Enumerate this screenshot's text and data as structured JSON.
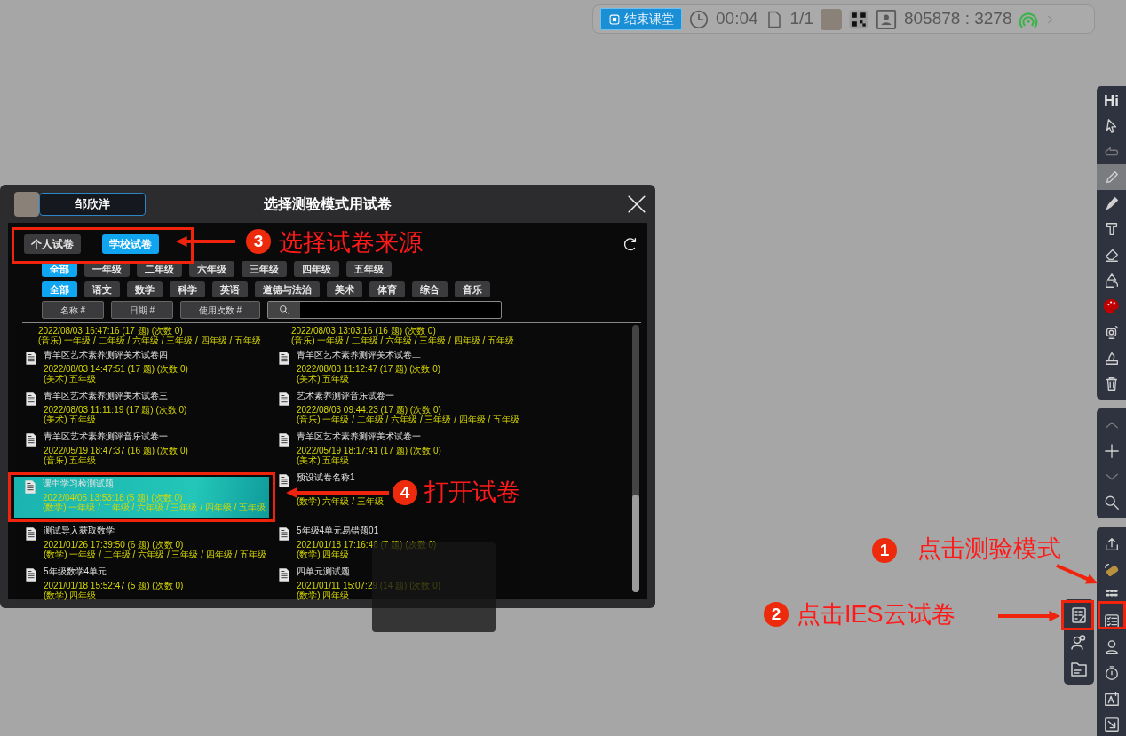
{
  "status_bar": {
    "end_button": "结束课堂",
    "timer": "00:04",
    "pages": "1/1",
    "room_code": "805878 : 3278"
  },
  "dialog": {
    "user_name": "邹欣洋",
    "title": "选择测验模式用试卷",
    "source_tabs": [
      {
        "label": "个人试卷",
        "selected": false
      },
      {
        "label": "学校试卷",
        "selected": true
      }
    ],
    "grade_filters": [
      {
        "label": "全部",
        "selected": true
      },
      {
        "label": "一年级",
        "selected": false
      },
      {
        "label": "二年级",
        "selected": false
      },
      {
        "label": "六年级",
        "selected": false
      },
      {
        "label": "三年级",
        "selected": false
      },
      {
        "label": "四年级",
        "selected": false
      },
      {
        "label": "五年级",
        "selected": false
      }
    ],
    "subject_filters": [
      {
        "label": "全部",
        "selected": true
      },
      {
        "label": "语文",
        "selected": false
      },
      {
        "label": "数学",
        "selected": false
      },
      {
        "label": "科学",
        "selected": false
      },
      {
        "label": "英语",
        "selected": false
      },
      {
        "label": "道德与法治",
        "selected": false
      },
      {
        "label": "美术",
        "selected": false
      },
      {
        "label": "体育",
        "selected": false
      },
      {
        "label": "综合",
        "selected": false
      },
      {
        "label": "音乐",
        "selected": false
      }
    ],
    "sort_buttons": [
      "名称 #",
      "日期 #",
      "使用次数 #"
    ],
    "papers": [
      {
        "date": "2022/08/03 16:47:16 (17 题) (次数 0)",
        "tags": "(音乐) 一年级 / 二年级 / 六年级 / 三年级 / 四年级 / 五年级",
        "selected": false
      },
      {
        "date": "2022/08/03 13:03:16 (16 题) (次数 0)",
        "tags": "(音乐) 一年级 / 二年级 / 六年级 / 三年级 / 四年级 / 五年级",
        "selected": false
      },
      {
        "title": "青羊区艺术素养测评美术试卷四",
        "date": "2022/08/03 14:47:51 (17 题) (次数 0)",
        "tags": "(美术) 五年级",
        "selected": false
      },
      {
        "title": "青羊区艺术素养测评美术试卷二",
        "date": "2022/08/03 11:12:47 (17 题) (次数 0)",
        "tags": "(美术) 五年级",
        "selected": false
      },
      {
        "title": "青羊区艺术素养测评美术试卷三",
        "date": "2022/08/03 11:11:19 (17 题) (次数 0)",
        "tags": "(美术) 五年级",
        "selected": false
      },
      {
        "title": "艺术素养测评音乐试卷一",
        "date": "2022/08/03 09:44:23 (17 题) (次数 0)",
        "tags": "(音乐) 一年级 / 二年级 / 六年级 / 三年级 / 四年级 / 五年级",
        "selected": false
      },
      {
        "title": "青羊区艺术素养测评音乐试卷一",
        "date": "2022/05/19 18:47:37 (16 题) (次数 0)",
        "tags": "(音乐) 五年级",
        "selected": false
      },
      {
        "title": "青羊区艺术素养测评美术试卷一",
        "date": "2022/05/19 18:17:41 (17 题) (次数 0)",
        "tags": "(美术) 五年级",
        "selected": false
      },
      {
        "title": "课中学习检测试题",
        "date": "2022/04/05 13:53:18 (5 题) (次数 0)",
        "tags": "(数学) 一年级 / 二年级 / 六年级 / 三年级 / 四年级 / 五年级",
        "selected": true
      },
      {
        "title": "预设试卷名称1",
        "tags": "(数学) 六年级 / 三年级",
        "selected": false
      },
      {
        "title": "测试导入获取数学",
        "date": "2021/01/26 17:39:50 (6 题) (次数 0)",
        "tags": "(数学) 一年级 / 二年级 / 六年级 / 三年级 / 四年级 / 五年级",
        "selected": false
      },
      {
        "title": "5年级4单元易错题01",
        "date": "2021/01/18 17:16:46 (7 题) (次数 0)",
        "tags": "(数学) 四年级",
        "selected": false
      },
      {
        "title": "5年级数学4单元",
        "date": "2021/01/18 15:52:47 (5 题) (次数 0)",
        "tags": "(数学) 四年级",
        "selected": false
      },
      {
        "title": "四单元测试题",
        "date": "2021/01/11 15:07:29 (14 题) (次数 0)",
        "tags": "(数学) 四年级",
        "selected": false
      }
    ]
  },
  "toolbar": {
    "logo": "Hi",
    "tools": [
      {
        "selected": false
      },
      {
        "selected": false
      },
      {
        "selected": true
      },
      {
        "selected": false
      },
      {
        "selected": false
      },
      {
        "selected": false
      },
      {
        "selected": false
      },
      {
        "selected": false
      },
      {
        "selected": false
      },
      {
        "selected": false
      },
      {
        "selected": false
      }
    ]
  },
  "annotations": [
    {
      "number": "3",
      "text": "选择试卷来源"
    },
    {
      "number": "4",
      "text": "打开试卷"
    },
    {
      "number": "1",
      "text": "点击测验模式"
    },
    {
      "number": "2",
      "text": "点击IES云试卷"
    }
  ]
}
